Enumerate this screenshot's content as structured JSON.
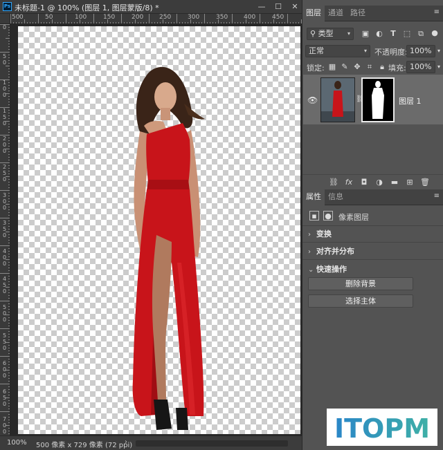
{
  "document": {
    "title": "未标题-1 @ 100% (图层 1, 图层蒙版/8) *",
    "app_icon": "Ps",
    "window_controls": {
      "minimize": "—",
      "maximize": "☐",
      "close": "✕"
    },
    "ruler_top_labels": [
      "50",
      "0",
      "50",
      "100",
      "150",
      "200",
      "250",
      "300",
      "350",
      "400",
      "450"
    ],
    "ruler_left_labels": [
      "0",
      "50",
      "100",
      "150",
      "200",
      "250",
      "300",
      "350",
      "400",
      "450",
      "500",
      "550",
      "600",
      "650",
      "700"
    ],
    "status": {
      "zoom": "100%",
      "info": "500 像素 x 729 像素 (72 ppi)",
      "arrow": "›"
    }
  },
  "layers_panel": {
    "tabs": [
      "图层",
      "通道",
      "路径"
    ],
    "active_tab": "图层",
    "filter_kind": "类型",
    "blend_mode": "正常",
    "opacity_label": "不透明度:",
    "opacity_value": "100%",
    "lock_label": "锁定:",
    "fill_label": "填充:",
    "fill_value": "100%",
    "layer": {
      "name": "图层 1",
      "visible": true
    },
    "footer_icons": [
      "link-icon",
      "fx-icon",
      "mask-icon",
      "adjustment-icon",
      "folder-icon",
      "new-layer-icon",
      "trash-icon"
    ]
  },
  "properties_panel": {
    "tabs": [
      "属性",
      "信息"
    ],
    "active_tab": "属性",
    "layer_type": "像素图层",
    "sections": [
      "变换",
      "对齐并分布",
      "快速操作"
    ],
    "buttons": [
      "删除背景",
      "选择主体"
    ]
  },
  "watermark": {
    "text": "ITOPM"
  },
  "colors": {
    "panel_bg": "#535353",
    "tab_bg": "#424242",
    "selected_layer": "#6b6b6b",
    "dress_red": "#c8141a",
    "watermark_blue": "#2a86c8",
    "watermark_teal": "#3fb0a6"
  }
}
